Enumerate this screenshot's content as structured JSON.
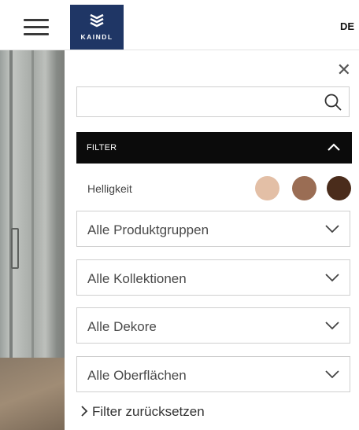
{
  "header": {
    "logo_text": "KAINDL",
    "language": "DE",
    "brand_color": "#1f3665"
  },
  "panel": {
    "search": {
      "value": "",
      "placeholder": ""
    },
    "filter_bar": {
      "label": "FILTER",
      "expanded": true
    },
    "brightness": {
      "label": "Helligkeit",
      "swatches": [
        {
          "name": "light",
          "color": "#e3bfa6"
        },
        {
          "name": "medium",
          "color": "#9a6d54"
        },
        {
          "name": "dark",
          "color": "#4a2c1b"
        }
      ]
    },
    "dropdowns": [
      {
        "label": "Alle Produktgruppen"
      },
      {
        "label": "Alle Kollektionen"
      },
      {
        "label": "Alle Dekore"
      },
      {
        "label": "Alle Oberflächen"
      }
    ],
    "reset_label": "Filter zurücksetzen"
  },
  "icons": [
    "hamburger-icon",
    "kaindl-logo-icon",
    "close-icon",
    "search-icon",
    "chevron-up-icon",
    "chevron-down-icon",
    "chevron-right-icon"
  ]
}
